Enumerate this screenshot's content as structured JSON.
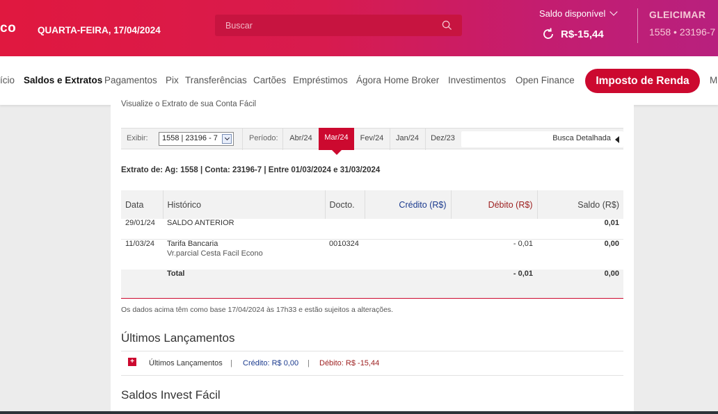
{
  "header": {
    "logo_fragment": "co",
    "date": "QUARTA-FEIRA, 17/04/2024",
    "search_placeholder": "Buscar",
    "balance_label": "Saldo disponível",
    "balance_value": "R$-15,44",
    "user_name": "GLEICIMAR",
    "user_account": "1558 • 23196-7"
  },
  "nav": {
    "items": [
      "ício",
      "Saldos e Extratos",
      "Pagamentos",
      "Pix",
      "Transferências",
      "Cartões",
      "Empréstimos",
      "Ágora Home Broker",
      "Investimentos",
      "Open Finance"
    ],
    "highlight_button": "Imposto de Renda",
    "overflow": "M"
  },
  "content": {
    "cut_text": "Visualize o Extrato de sua Conta Fácil",
    "filter": {
      "exibir_label": "Exibir:",
      "account_selected": "1558 | 23196 - 7",
      "periodo_label": "Período:",
      "months": [
        "Abr/24",
        "Mar/24",
        "Fev/24",
        "Jan/24",
        "Dez/23"
      ],
      "active_month": "Mar/24",
      "busca_detalhada": "Busca Detalhada"
    },
    "extrato_info": "Extrato de: Ag: 1558 | Conta: 23196-7 | Entre 01/03/2024 e 31/03/2024",
    "table": {
      "headers": [
        "Data",
        "Histórico",
        "Docto.",
        "Crédito (R$)",
        "Débito (R$)",
        "Saldo (R$)"
      ],
      "rows": [
        {
          "data": "29/01/24",
          "historico": "SALDO ANTERIOR",
          "sub": "",
          "docto": "",
          "credito": "",
          "debito": "",
          "saldo": "0,01"
        },
        {
          "data": "11/03/24",
          "historico": "Tarifa Bancaria",
          "sub": "Vr.parcial Cesta Facil Econo",
          "docto": "0010324",
          "credito": "",
          "debito": "- 0,01",
          "saldo": "0,00"
        }
      ],
      "total_label": "Total",
      "total_debito": "- 0,01",
      "total_saldo": "0,00"
    },
    "note": "Os dados acima têm como base 17/04/2024 às 17h33 e estão sujeitos a alterações.",
    "ultimos": {
      "title": "Últimos Lançamentos",
      "row_label": "Últimos Lançamentos",
      "credito": "Crédito: R$ 0,00",
      "debito": "Débito: R$ -15,44",
      "sep": "|"
    },
    "invest_title": "Saldos Invest Fácil"
  },
  "colors": {
    "brand_red": "#cc092f",
    "credit_blue": "#1a3a8e",
    "debit_red": "#9c1d1d"
  }
}
